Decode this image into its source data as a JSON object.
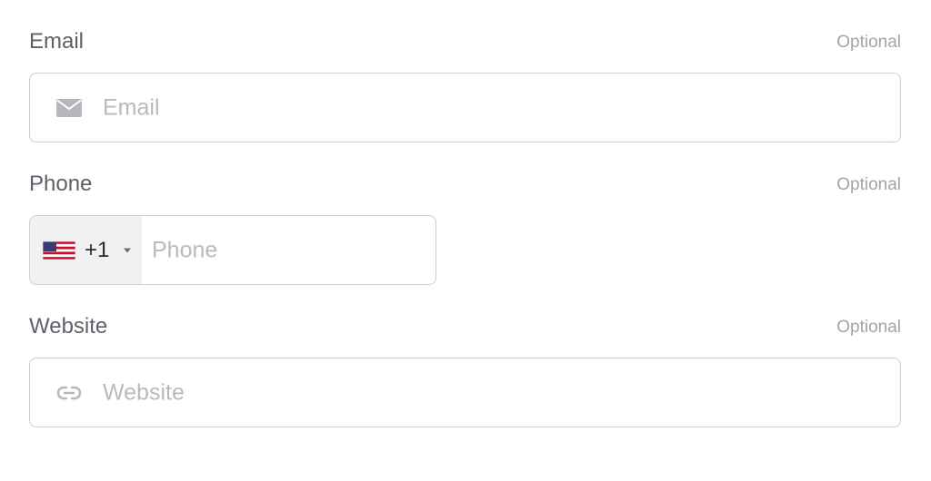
{
  "fields": {
    "email": {
      "label": "Email",
      "optional": "Optional",
      "placeholder": "Email",
      "icon": "envelope-icon"
    },
    "phone": {
      "label": "Phone",
      "optional": "Optional",
      "placeholder": "Phone",
      "country_flag": "us-flag-icon",
      "dial_code": "+1",
      "dropdown_icon": "caret-down-icon"
    },
    "website": {
      "label": "Website",
      "optional": "Optional",
      "placeholder": "Website",
      "icon": "link-icon"
    }
  },
  "colors": {
    "label": "#5f5f68",
    "optional": "#a3a3ab",
    "placeholder": "#b9b9bf",
    "border": "#cfcfd3",
    "country_bg": "#f1f1f3"
  }
}
